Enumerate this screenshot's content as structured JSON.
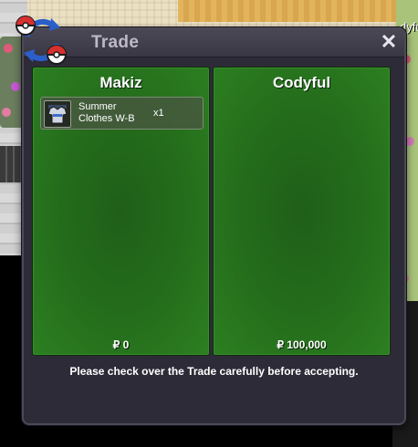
{
  "window": {
    "title": "Trade",
    "close_symbol": "✕"
  },
  "world": {
    "npc_name_fragment": "dyfu"
  },
  "trade": {
    "left": {
      "player_name": "Makiz",
      "money": "₽ 0",
      "items": [
        {
          "name_line1": "Summer",
          "name_line2": "Clothes W-B",
          "quantity": "x1",
          "icon": "clothes-icon"
        }
      ]
    },
    "right": {
      "player_name": "Codyful",
      "money": "₽ 100,000",
      "items": []
    },
    "message": "Please check over the Trade carefully before accepting."
  },
  "colors": {
    "window_bg": "#2e2b38",
    "panel_green": "#256e1c",
    "title_text": "#bdbac6"
  }
}
